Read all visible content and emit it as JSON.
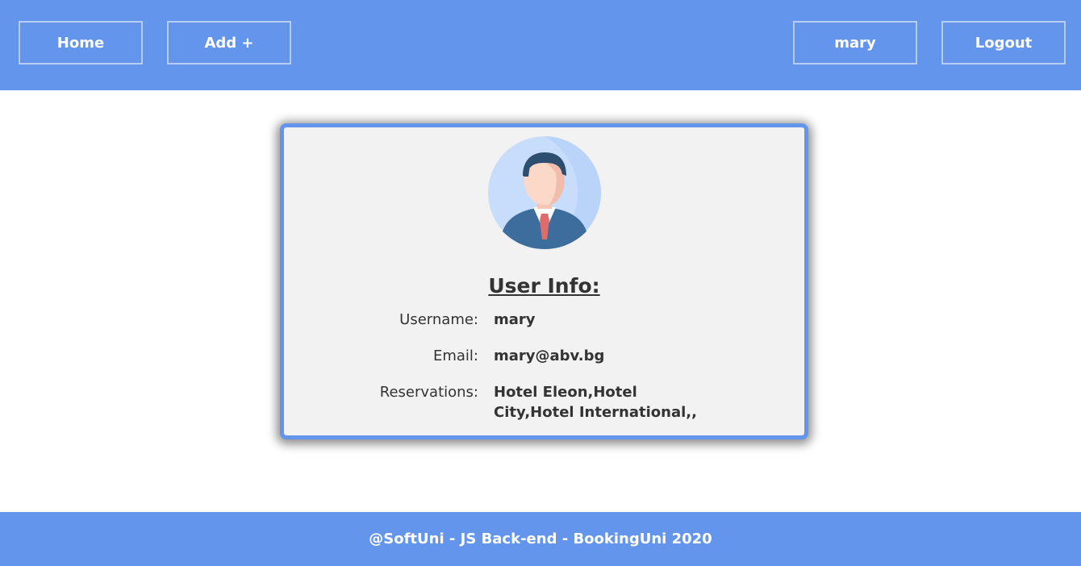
{
  "header": {
    "home_label": "Home",
    "add_label": "Add +",
    "user_label": "mary",
    "logout_label": "Logout"
  },
  "profile": {
    "title": "User Info:",
    "username_label": "Username:",
    "username_value": "mary",
    "email_label": "Email:",
    "email_value": "mary@abv.bg",
    "reservations_label": "Reservations:",
    "reservations_value": "Hotel Eleon,Hotel City,Hotel International,,"
  },
  "footer": {
    "text": "@SoftUni - JS Back-end - BookingUni 2020"
  },
  "colors": {
    "brand": "#6495ed",
    "card_bg": "#f2f2f2",
    "text": "#333333"
  },
  "icons": {
    "avatar": "user-avatar-icon"
  }
}
